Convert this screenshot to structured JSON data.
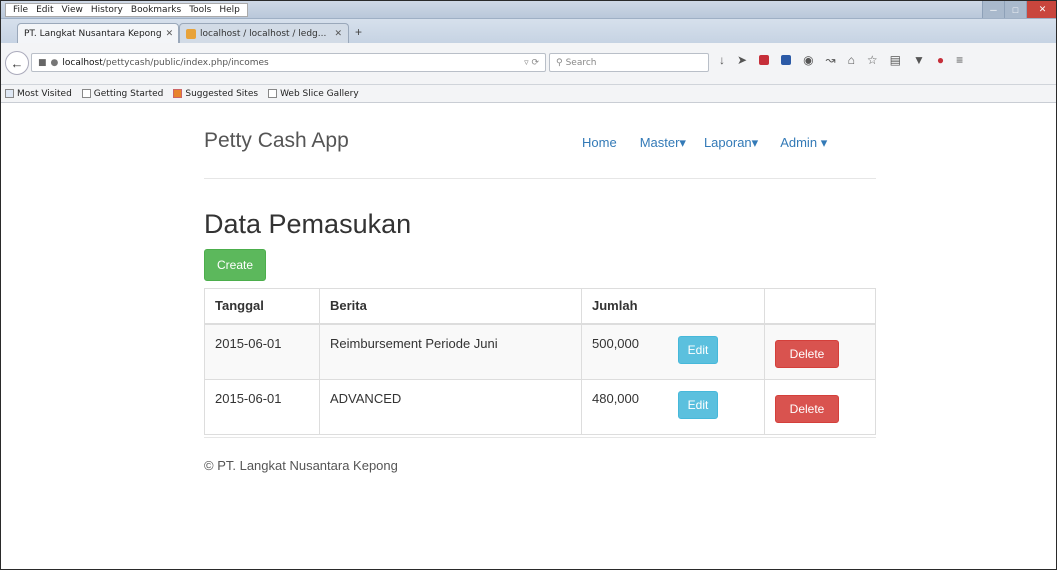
{
  "browser": {
    "menu": [
      "File",
      "Edit",
      "View",
      "History",
      "Bookmarks",
      "Tools",
      "Help"
    ],
    "tabs": [
      {
        "title": "PT. Langkat Nusantara Kepong"
      },
      {
        "title": "localhost / localhost / ledg..."
      }
    ],
    "url": {
      "host": "localhost",
      "path": "/pettycash/public/index.php/incomes"
    },
    "search_placeholder": "Search",
    "bookmarks": [
      "Most Visited",
      "Getting Started",
      "Suggested Sites",
      "Web Slice Gallery"
    ],
    "colors": {
      "titlebar": "#c4d1e2",
      "close": "#c9463d"
    }
  },
  "app": {
    "brand": "Petty Cash App",
    "nav": {
      "home": "Home",
      "master": "Master",
      "laporan": "Laporan",
      "admin": "Admin"
    },
    "page_title": "Data Pemasukan",
    "create_label": "Create",
    "table": {
      "headers": [
        "Tanggal",
        "Berita",
        "Jumlah",
        ""
      ],
      "rows": [
        {
          "tanggal": "2015-06-01",
          "berita": "Reimbursement Periode Juni",
          "jumlah": "500,000",
          "edit": "Edit",
          "delete": "Delete"
        },
        {
          "tanggal": "2015-06-01",
          "berita": "ADVANCED",
          "jumlah": "480,000",
          "edit": "Edit",
          "delete": "Delete"
        }
      ]
    },
    "footer": "© PT. Langkat Nusantara Kepong",
    "colors": {
      "create": "#5cb85c",
      "edit": "#5bc0de",
      "delete": "#d9534f",
      "link": "#337ab7"
    }
  }
}
